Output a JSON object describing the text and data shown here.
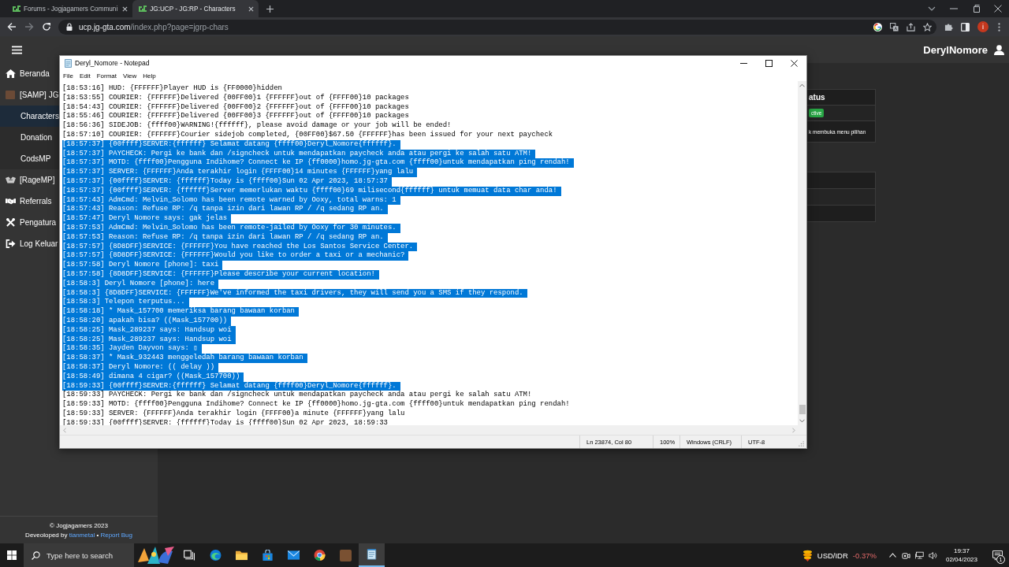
{
  "browser": {
    "tabs": [
      {
        "title": "Forums - Jogjagamers Communi",
        "selected": false
      },
      {
        "title": "JG:UCP - JG:RP - Characters",
        "selected": true
      }
    ],
    "nav": [
      {
        "disabled": false
      },
      {
        "disabled": true
      },
      {
        "disabled": false
      }
    ],
    "address": {
      "host": "ucp.jg-gta.com",
      "path": "/index.php?page=jgrp-chars"
    },
    "profile_initial": "i"
  },
  "page": {
    "user": "DerylNomore",
    "sidebar": {
      "items": [
        {
          "label": "Beranda",
          "selected": false
        },
        {
          "label": "[SAMP] JG",
          "selected": false,
          "children": [
            {
              "label": "Characters",
              "selected": true
            },
            {
              "label": "Donation",
              "selected": false
            },
            {
              "label": "CodsMP",
              "selected": false
            }
          ]
        },
        {
          "label": "[RageMP]",
          "selected": false
        },
        {
          "label": "Referrals",
          "selected": false
        },
        {
          "label": "Pengatura",
          "selected": false
        },
        {
          "label": "Log Keluar",
          "selected": false
        }
      ]
    },
    "footer": {
      "copyright": "© Jogjagamers 2023",
      "credit": "Deveoloped by",
      "author": "tianmetal",
      "separator": "•",
      "link": "Report Bug"
    },
    "status_table": {
      "header": "atus",
      "badge": "ctive",
      "note": "k membuka menu pilihan"
    }
  },
  "notepad": {
    "title": "Deryl_Nomore - Notepad",
    "menu": [
      "File",
      "Edit",
      "Format",
      "View",
      "Help"
    ],
    "lines": [
      {
        "text": "[18:53:16] HUD: {FFFFFF}Player HUD is {FF0000}hidden",
        "selected": false
      },
      {
        "text": "[18:53:55] COURIER: {FFFFFF}Delivered {00FF00}1 {FFFFFF}out of {FFFF00}10 packages",
        "selected": false
      },
      {
        "text": "[18:54:43] COURIER: {FFFFFF}Delivered {00FF00}2 {FFFFFF}out of {FFFF00}10 packages",
        "selected": false
      },
      {
        "text": "[18:55:46] COURIER: {FFFFFF}Delivered {00FF00}3 {FFFFFF}out of {FFFF00}10 packages",
        "selected": false
      },
      {
        "text": "[18:56:36] SIDEJOB: {ffff00}WARNING!{ffffff}, please avoid damage or your job will be ended!",
        "selected": false
      },
      {
        "text": "[18:57:10] COURIER: {FFFFFF}Courier sidejob completed, {00FF00}$67.50 {FFFFFF}has been issued for your next paycheck",
        "selected": false
      },
      {
        "text": "[18:57:37] {00ffff}SERVER:{ffffff} Selamat datang {ffff00}Deryl_Nomore{ffffff}.",
        "selected": true
      },
      {
        "text": "[18:57:37] PAYCHECK: Pergi ke bank dan /signcheck untuk mendapatkan paycheck anda atau pergi ke salah satu ATM!",
        "selected": true
      },
      {
        "text": "[18:57:37] MOTD: {ffff00}Pengguna Indihome? Connect ke IP {ff0000}homo.jg-gta.com {ffff00}untuk mendapatkan ping rendah!",
        "selected": true
      },
      {
        "text": "[18:57:37] SERVER: {FFFFFF}Anda terakhir login {FFFF00}14 minutes {FFFFFF}yang lalu",
        "selected": true
      },
      {
        "text": "[18:57:37] {00ffff}SERVER: {ffffff}Today is {ffff00}Sun 02 Apr 2023, 18:57:37",
        "selected": true
      },
      {
        "text": "[18:57:37] {00ffff}SERVER: {ffffff}Server memerlukan waktu {ffff00}69 milisecond{ffffff} untuk memuat data char anda!",
        "selected": true
      },
      {
        "text": "[18:57:43] AdmCmd: Melvin_Solomo has been remote warned by Ooxy, total warns: 1",
        "selected": true
      },
      {
        "text": "[18:57:43] Reason: Refuse RP: /q tanpa izin dari lawan RP / /q sedang RP an.",
        "selected": true
      },
      {
        "text": "[18:57:47] Deryl Nomore says: gak jelas",
        "selected": true
      },
      {
        "text": "[18:57:53] AdmCmd: Melvin_Solomo has been remote-jailed by Ooxy for 30 minutes.",
        "selected": true
      },
      {
        "text": "[18:57:53] Reason: Refuse RP: /q tanpa izin dari lawan RP / /q sedang RP an.",
        "selected": true
      },
      {
        "text": "[18:57:57] {8D8DFF}SERVICE: {FFFFFF}You have reached the Los Santos Service Center.",
        "selected": true
      },
      {
        "text": "[18:57:57] {8D8DFF}SERVICE: {FFFFFF}Would you like to order a taxi or a mechanic?",
        "selected": true
      },
      {
        "text": "[18:57:58] Deryl Nomore [phone]: taxi",
        "selected": true
      },
      {
        "text": "[18:57:58] {8D8DFF}SERVICE: {FFFFFF}Please describe your current location!",
        "selected": true
      },
      {
        "text": "[18:58:3] Deryl Nomore [phone]: here",
        "selected": true
      },
      {
        "text": "[18:58:3] {8D8DFF}SERVICE: {FFFFFF}We've informed the taxi drivers, they will send you a SMS if they respond.",
        "selected": true
      },
      {
        "text": "[18:58:3] Telepon terputus...",
        "selected": true
      },
      {
        "text": "[18:58:18] * Mask_157700 memeriksa barang bawaan korban",
        "selected": true
      },
      {
        "text": "[18:58:20] apakah bisa? ((Mask_157700))",
        "selected": true
      },
      {
        "text": "[18:58:25] Mask_289237 says: Handsup woi",
        "selected": true
      },
      {
        "text": "[18:58:25] Mask_289237 says: Handsup woi",
        "selected": true
      },
      {
        "text": "[18:58:35] Jayden Dayvon says: ▯",
        "selected": true
      },
      {
        "text": "[18:58:37] * Mask_932443 menggeledah barang bawaan korban",
        "selected": true
      },
      {
        "text": "[18:58:37] Deryl Nomore: (( delay ))",
        "selected": true
      },
      {
        "text": "[18:58:49] dimana 4 cigar? ((Mask_157700))",
        "selected": true
      },
      {
        "text": "[18:59:33] {00ffff}SERVER:{ffffff} Selamat datang {ffff00}Deryl_Nomore{ffffff}.",
        "selected": true
      },
      {
        "text": "[18:59:33] PAYCHECK: Pergi ke bank dan /signcheck untuk mendapatkan paycheck anda atau pergi ke salah satu ATM!",
        "selected": false
      },
      {
        "text": "[18:59:33] MOTD: {ffff00}Pengguna Indihome? Connect ke IP {ff0000}homo.jg-gta.com {ffff00}untuk mendapatkan ping rendah!",
        "selected": false
      },
      {
        "text": "[18:59:33] SERVER: {FFFFFF}Anda terakhir login {FFFF00}a minute {FFFFFF}yang lalu",
        "selected": false
      },
      {
        "text": "[18:59:33] {00ffff}SERVER: {ffffff}Today is {ffff00}Sun 02 Apr 2023, 18:59:33",
        "selected": false
      }
    ],
    "status_bar": [
      "Ln 23874, Col 80",
      "100%",
      "Windows (CRLF)",
      "UTF-8"
    ]
  },
  "taskbar": {
    "search": {
      "placeholder": "Type here to search"
    },
    "apps": [
      {
        "selected": false
      },
      {
        "selected": false
      },
      {
        "selected": false
      },
      {
        "selected": false
      },
      {
        "selected": false
      },
      {
        "selected": false
      },
      {
        "selected": false
      },
      {
        "selected": true
      }
    ],
    "widget": {
      "pair": "USD/IDR",
      "change": "-0.37%"
    },
    "clock": {
      "time": "19:37",
      "date": "02/04/2023"
    },
    "notifications": {
      "count": "1"
    }
  }
}
